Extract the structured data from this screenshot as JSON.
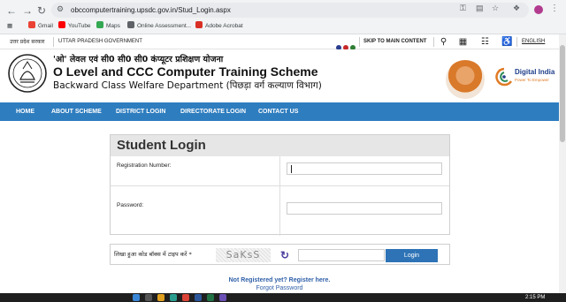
{
  "browser": {
    "url": "obccomputertraining.upsdc.gov.in/Stud_Login.aspx",
    "bookmarks": [
      "Gmail",
      "YouTube",
      "Maps",
      "Online Assessment...",
      "Adobe Acrobat"
    ]
  },
  "govbar": {
    "state_hindi": "उत्तर प्रदेश सरकार",
    "state_english": "UTTAR PRADESH GOVERNMENT",
    "skip": "SKIP TO MAIN CONTENT",
    "language": "ENGLISH"
  },
  "header": {
    "hindi_title": "'ओ' लेवल एवं सी0 सी0 सी0 कंप्यूटर प्रशिक्षण योजना",
    "title": "O Level and CCC Computer Training Scheme",
    "subtitle": "Backward Class Welfare Department (पिछड़ा वर्ग कल्याण विभाग)",
    "digital_india": "Digital India",
    "digital_india_tag": "Power To Empower"
  },
  "nav": {
    "items": [
      "HOME",
      "ABOUT SCHEME",
      "DISTRICT LOGIN",
      "DIRECTORATE LOGIN",
      "CONTACT US"
    ]
  },
  "login": {
    "title": "Student Login",
    "registration_label": "Registration Number:",
    "password_label": "Password:",
    "captcha_label": "लिखा हुआ कोड बॉक्स में टाइप करें *",
    "captcha_text": "SaKsS",
    "login_button": "Login",
    "register_link": "Not Registered yet? Register here.",
    "forgot_link": "Forgot Password"
  },
  "taskbar": {
    "time": "2:15 PM"
  },
  "colors": {
    "nav_bg": "#2e7dbf",
    "login_button": "#2e73b6",
    "link": "#2f5fa8"
  }
}
